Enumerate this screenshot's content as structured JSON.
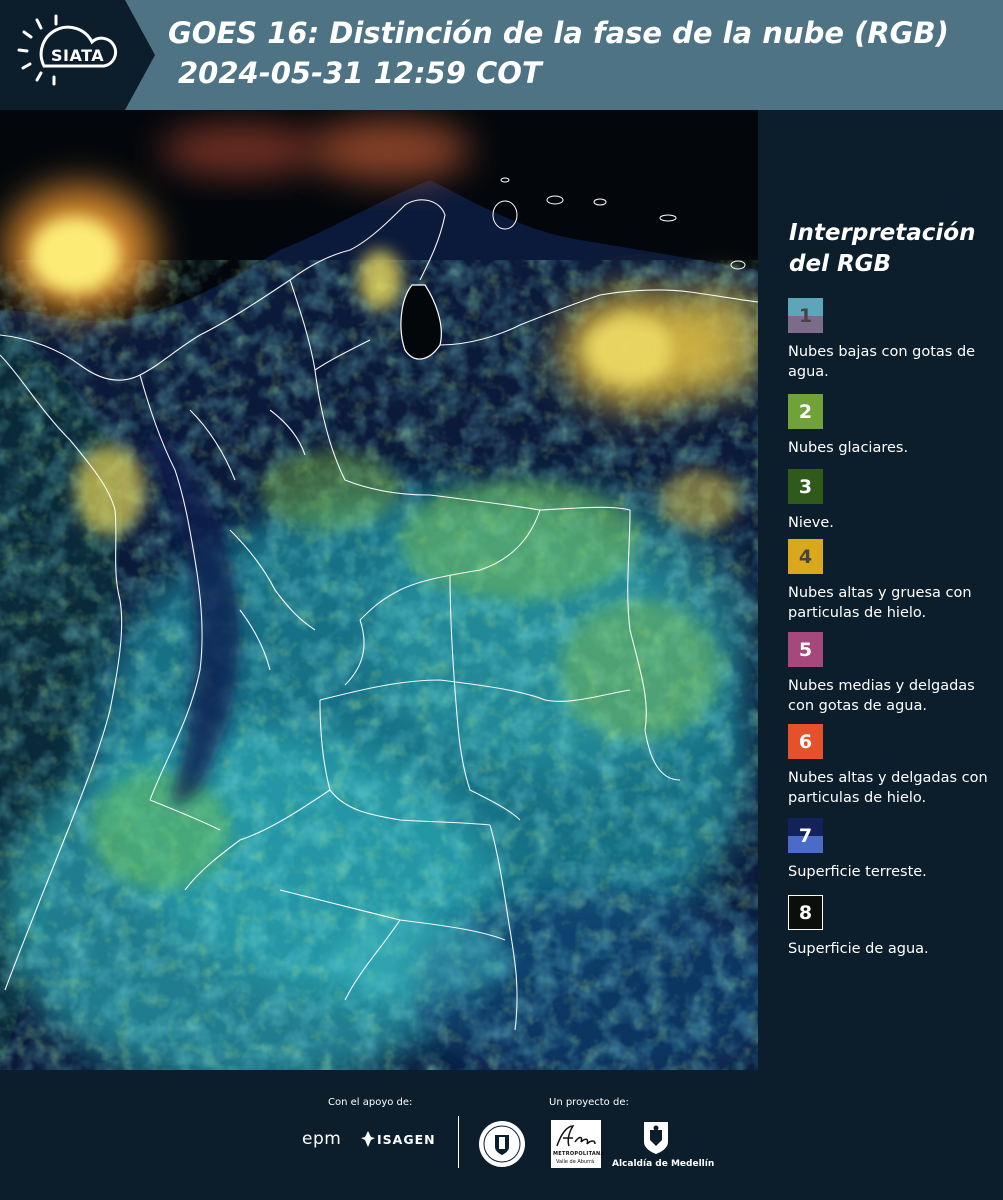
{
  "header": {
    "logo_text": "SIATA",
    "title_line1": "GOES 16: Distinción de la fase de la nube (RGB)",
    "title_line2": "2024-05-31 12:59 COT"
  },
  "legend": {
    "title": "Interpretación del RGB",
    "items": [
      {
        "number": "1",
        "label": "Nubes bajas con gotas de agua.",
        "color_top": "#5ba7b9",
        "color_bottom": "#7c6c8a"
      },
      {
        "number": "2",
        "label": "Nubes glaciares.",
        "color": "#6fa33a"
      },
      {
        "number": "3",
        "label": "Nieve.",
        "color": "#2f5a1c"
      },
      {
        "number": "4",
        "label": "Nubes altas y gruesa con particulas de hielo.",
        "color": "#d9a81c"
      },
      {
        "number": "5",
        "label": "Nubes medias y delgadas con gotas de agua.",
        "color": "#a5487c"
      },
      {
        "number": "6",
        "label": "Nubes altas y delgadas con particulas de hielo.",
        "color": "#e4512a"
      },
      {
        "number": "7",
        "label": "Superficie terreste.",
        "color_top": "#13235a",
        "color_bottom": "#4a6cc8"
      },
      {
        "number": "8",
        "label": "Superficie de agua.",
        "color": "#0a0f0b"
      }
    ]
  },
  "footer": {
    "support_label": "Con el apoyo de:",
    "project_label": "Un proyecto de:",
    "epm": "epm",
    "isagen": "ISAGEN",
    "metropolitana_1": "METROPOLITANA",
    "metropolitana_2": "Valle de Aburrá",
    "alcaldia": "Alcaldía de Medellín"
  }
}
